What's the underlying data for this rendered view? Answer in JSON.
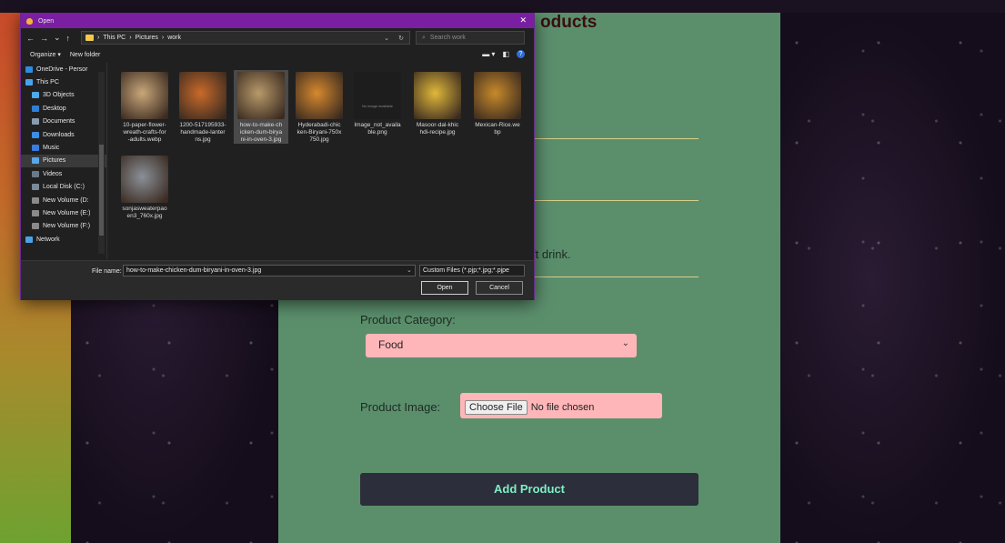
{
  "page": {
    "title_partial": "oducts",
    "text_partial": "ft drink.",
    "category_label": "Product Category:",
    "category_value": "Food",
    "image_label": "Product Image:",
    "choose_file": "Choose File",
    "no_file": "No file chosen",
    "add_button": "Add Product"
  },
  "dialog": {
    "title": "Open",
    "close": "✕",
    "breadcrumb": [
      "This PC",
      "Pictures",
      "work"
    ],
    "search_placeholder": "Search work",
    "organize": "Organize ▾",
    "new_folder": "New folder",
    "nav_items": [
      {
        "label": "OneDrive - Persor",
        "color": "#2d8de0"
      },
      {
        "label": "This PC",
        "color": "#4aa3ea"
      },
      {
        "label": "3D Objects",
        "color": "#4fa8e8"
      },
      {
        "label": "Desktop",
        "color": "#2f7fd8"
      },
      {
        "label": "Documents",
        "color": "#8a9bb0"
      },
      {
        "label": "Downloads",
        "color": "#3a8ee6"
      },
      {
        "label": "Music",
        "color": "#3b7be0"
      },
      {
        "label": "Pictures",
        "color": "#5aa7e8"
      },
      {
        "label": "Videos",
        "color": "#6a7a8a"
      },
      {
        "label": "Local Disk (C:)",
        "color": "#7a8a9a"
      },
      {
        "label": "New Volume (D:",
        "color": "#8a8a8a"
      },
      {
        "label": "New Volume (E:)",
        "color": "#8a8a8a"
      },
      {
        "label": "New Volume (F:)",
        "color": "#8a8a8a"
      },
      {
        "label": "Network",
        "color": "#4aa3ea"
      }
    ],
    "files": [
      {
        "name": "10-paper-flower-wreath-crafts-for-adults.webp",
        "lines": [
          "10-paper-flower-",
          "wreath-crafts-for",
          "-adults.webp"
        ],
        "color": "#c9a77a"
      },
      {
        "name": "1200-517195933-handmade-lanterns.jpg",
        "lines": [
          "1200-517195933-",
          "handmade-lanter",
          "ns.jpg"
        ],
        "color": "#c96a2a"
      },
      {
        "name": "how-to-make-chicken-dum-biryani-in-oven-3.jpg",
        "lines": [
          "how-to-make-ch",
          "icken-dum-birya",
          "ni-in-oven-3.jpg"
        ],
        "color": "#b89a6a"
      },
      {
        "name": "Hyderabadi-chicken-Biryani-750x750.jpg",
        "lines": [
          "Hyderabadi-chic",
          "ken-Biryani-750x",
          "750.jpg"
        ],
        "color": "#d6892e"
      },
      {
        "name": "Image_not_available.png",
        "lines": [
          "Image_not_availa",
          "ble.png"
        ],
        "color": "#2a2a2a"
      },
      {
        "name": "Masoor-dal-khichdi-recipe.jpg",
        "lines": [
          "Masoor-dal-khic",
          "hdi-recipe.jpg"
        ],
        "color": "#e0b83a"
      },
      {
        "name": "Mexican-Rice.webp",
        "lines": [
          "Mexican-Rice.we",
          "bp"
        ],
        "color": "#c78a2a"
      },
      {
        "name": "sonjasweaterpaoen3_760x.jpg",
        "lines": [
          "sonjasweaterpao",
          "en3_760x.jpg"
        ],
        "color": "#8a9098"
      }
    ],
    "no_image_text": "No image available",
    "file_name_label": "File name:",
    "file_name_value": "how-to-make-chicken-dum-biryani-in-oven-3.jpg",
    "file_type": "Custom Files (*.pjp;*.jpg;*.pjpe",
    "open_button": "Open",
    "cancel_button": "Cancel"
  }
}
